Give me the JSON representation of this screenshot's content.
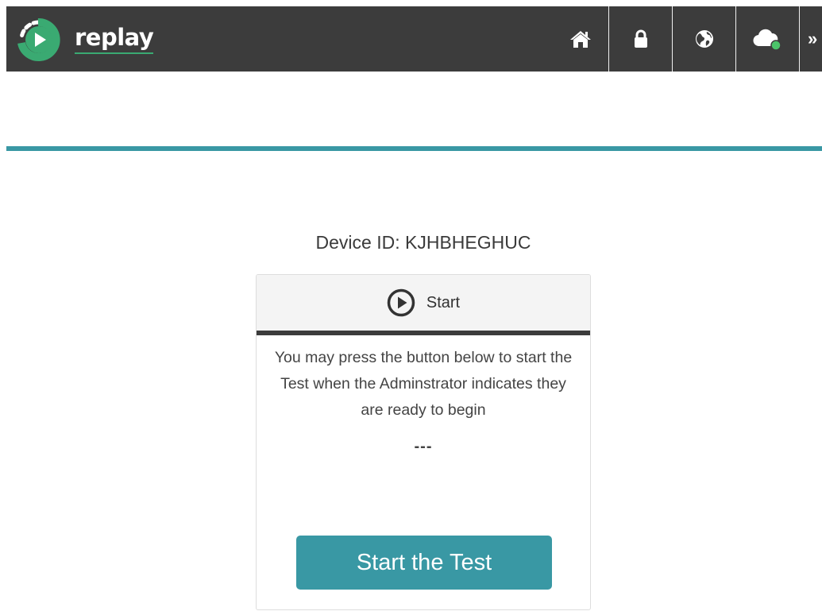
{
  "app": {
    "name": "replay",
    "brand_color": "#3aaa72",
    "accent_color": "#3998a4",
    "bar_color": "#3c3c3c"
  },
  "nav": {
    "items": [
      {
        "icon": "home-icon"
      },
      {
        "icon": "lock-icon"
      },
      {
        "icon": "globe-icon"
      },
      {
        "icon": "cloud-status-icon",
        "status_color": "#4cc46a"
      },
      {
        "icon": "double-chevron-right-icon",
        "label": "»"
      }
    ]
  },
  "main": {
    "device_id": "Device ID: KJHBHEGHUC"
  },
  "panel": {
    "title": "Start",
    "icon": "play-circle-icon",
    "instructions": "You may press the button below to start the Test when the Adminstrator indicates they are ready to begin",
    "status": "---",
    "button_label": "Start the Test"
  }
}
